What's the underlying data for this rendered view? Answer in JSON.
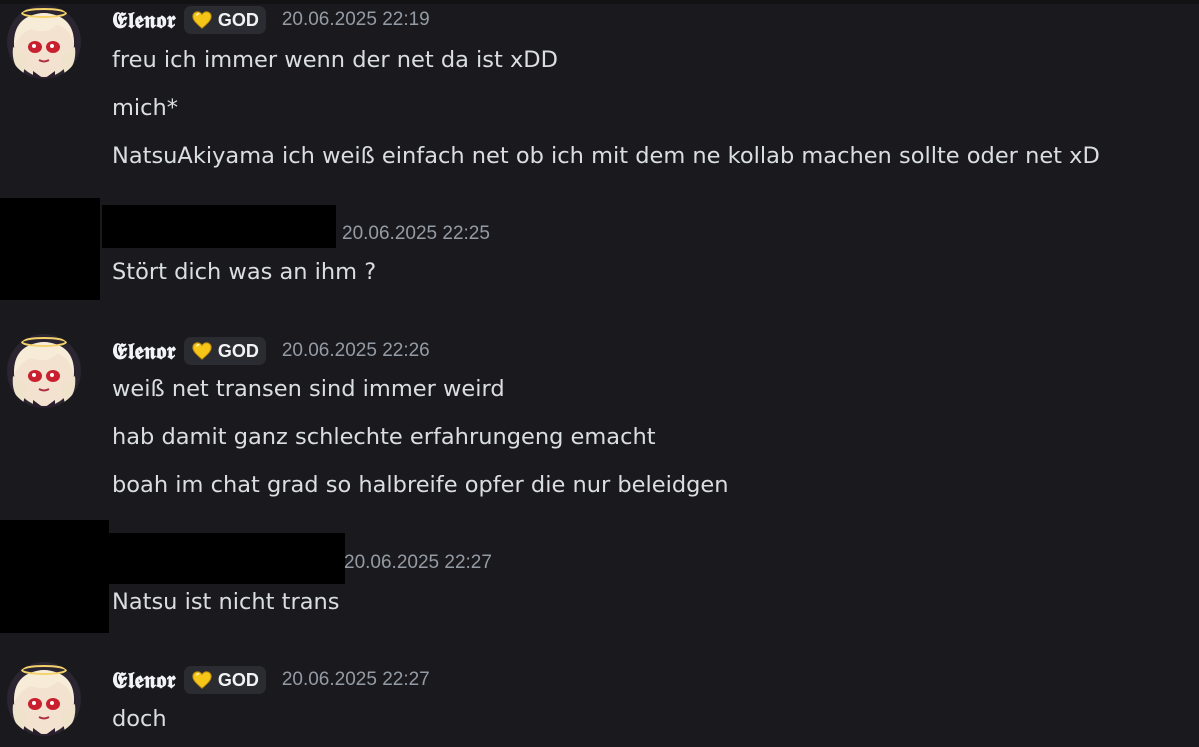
{
  "messages": [
    {
      "username": "𝕰𝖑𝖊𝖓𝖔𝖗",
      "tag": "GOD",
      "icon": "gold-heart-icon",
      "timestamp": "20.06.2025 22:19",
      "lines": [
        "freu ich immer wenn der net da ist xDD",
        "mich*",
        "NatsuAkiyama ich weiß einfach net ob ich mit dem ne kollab machen sollte oder net xD"
      ]
    },
    {
      "username": "",
      "timestamp": "20.06.2025 22:25",
      "lines": [
        "Stört dich was an ihm ?"
      ]
    },
    {
      "username": "𝕰𝖑𝖊𝖓𝖔𝖗",
      "tag": "GOD",
      "icon": "gold-heart-icon",
      "timestamp": "20.06.2025 22:26",
      "lines": [
        "weiß net transen sind immer weird",
        "hab damit ganz schlechte erfahrungeng emacht",
        "boah im chat grad so halbreife opfer die nur beleidgen"
      ]
    },
    {
      "username": "",
      "timestamp": "20.06.2025 22:27",
      "lines": [
        "Natsu ist nicht trans"
      ]
    },
    {
      "username": "𝕰𝖑𝖊𝖓𝖔𝖗",
      "tag": "GOD",
      "icon": "gold-heart-icon",
      "timestamp": "20.06.2025 22:27",
      "lines": [
        "doch"
      ]
    }
  ],
  "colors": {
    "background": "#1a1a1e",
    "text": "#dbdee1",
    "timestamp": "#949ba4",
    "tag_bg": "#2b2c31",
    "heart": "#f5c518"
  }
}
